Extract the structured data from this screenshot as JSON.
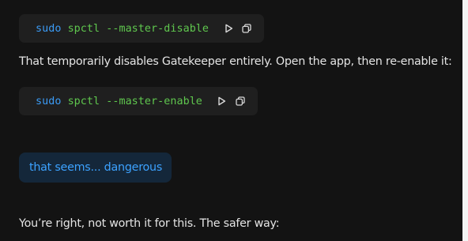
{
  "messages": {
    "code_block_1": {
      "command": "sudo",
      "args": " spctl --master-disable",
      "run_icon": "play-icon",
      "copy_icon": "copy-icon"
    },
    "assistant_text_1": "That temporarily disables Gatekeeper entirely. Open the app, then re-enable it:",
    "code_block_2": {
      "command": "sudo",
      "args": " spctl --master-enable",
      "run_icon": "play-icon",
      "copy_icon": "copy-icon"
    },
    "user_message": "that seems... dangerous",
    "assistant_text_2": "You’re right, not worth it for this. The safer way:"
  },
  "colors": {
    "background": "#131313",
    "code_background": "#1f1f1f",
    "command": "#3b9bf5",
    "argument": "#5fc74e",
    "text": "#e4e4e4",
    "user_bubble": "#14273a",
    "user_text": "#3ca2ff"
  }
}
